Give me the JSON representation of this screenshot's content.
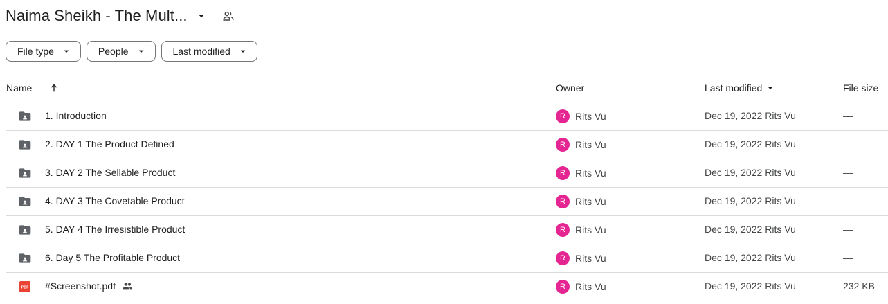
{
  "header": {
    "title": "Naima Sheikh - The Mult...",
    "title_caret_icon": "arrow-drop-down-icon",
    "shared_icon": "people-icon"
  },
  "filters": [
    {
      "label": "File type"
    },
    {
      "label": "People"
    },
    {
      "label": "Last modified"
    }
  ],
  "table": {
    "columns": {
      "name": "Name",
      "owner": "Owner",
      "last_modified": "Last modified",
      "file_size": "File size"
    },
    "rows": [
      {
        "name": "1. Introduction",
        "type": "folder",
        "owner_initial": "R",
        "owner": "Rits Vu",
        "date": "Dec 19, 2022",
        "modified_by": "Rits Vu",
        "size": "—",
        "shared": false
      },
      {
        "name": "2. DAY 1 The Product Defined",
        "type": "folder",
        "owner_initial": "R",
        "owner": "Rits Vu",
        "date": "Dec 19, 2022",
        "modified_by": "Rits Vu",
        "size": "—",
        "shared": false
      },
      {
        "name": "3. DAY 2 The Sellable Product",
        "type": "folder",
        "owner_initial": "R",
        "owner": "Rits Vu",
        "date": "Dec 19, 2022",
        "modified_by": "Rits Vu",
        "size": "—",
        "shared": false
      },
      {
        "name": "4. DAY 3 The Covetable Product",
        "type": "folder",
        "owner_initial": "R",
        "owner": "Rits Vu",
        "date": "Dec 19, 2022",
        "modified_by": "Rits Vu",
        "size": "—",
        "shared": false
      },
      {
        "name": "5. DAY 4 The Irresistible Product",
        "type": "folder",
        "owner_initial": "R",
        "owner": "Rits Vu",
        "date": "Dec 19, 2022",
        "modified_by": "Rits Vu",
        "size": "—",
        "shared": false
      },
      {
        "name": "6. Day 5 The Profitable Product",
        "type": "folder",
        "owner_initial": "R",
        "owner": "Rits Vu",
        "date": "Dec 19, 2022",
        "modified_by": "Rits Vu",
        "size": "—",
        "shared": false
      },
      {
        "name": "#Screenshot.pdf",
        "type": "pdf",
        "owner_initial": "R",
        "owner": "Rits Vu",
        "date": "Dec 19, 2022",
        "modified_by": "Rits Vu",
        "size": "232 KB",
        "shared": true
      }
    ]
  },
  "colors": {
    "avatar": "#e52592",
    "pdf_icon": "#ea4335",
    "folder_icon": "#5f6368",
    "border": "#dadce0"
  }
}
